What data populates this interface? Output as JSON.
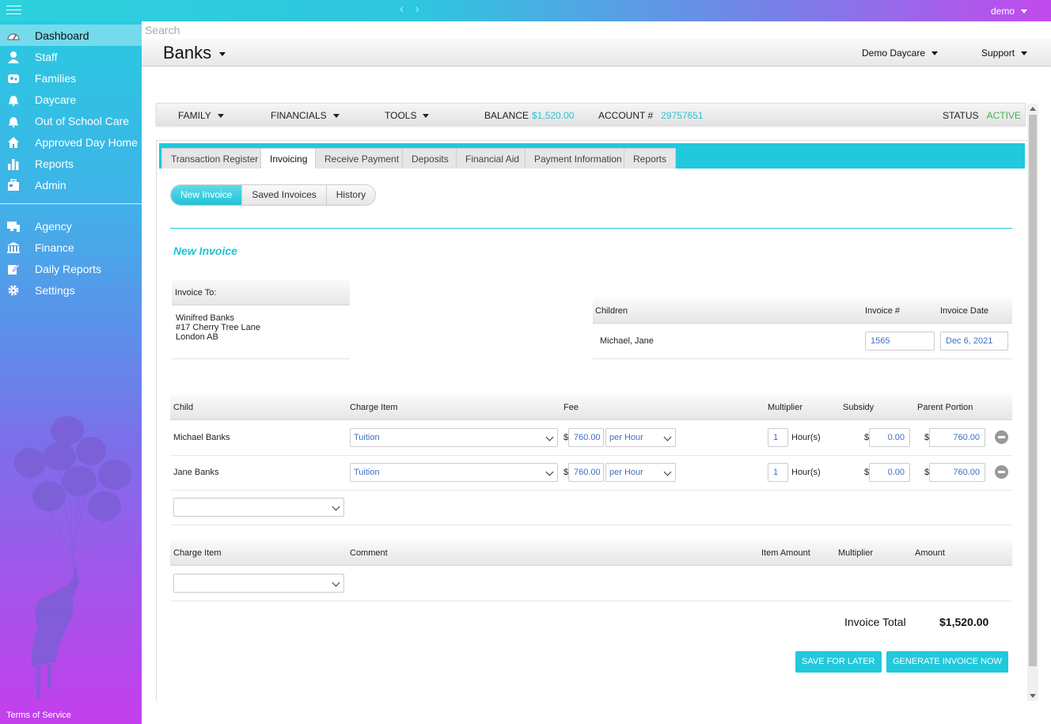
{
  "topbar": {
    "user": "demo"
  },
  "search": {
    "placeholder": "Search"
  },
  "header": {
    "title": "Banks",
    "daycare": "Demo Daycare",
    "support": "Support"
  },
  "sidebar": {
    "items": [
      {
        "label": "Dashboard",
        "icon": "gauge-icon"
      },
      {
        "label": "Staff",
        "icon": "person-icon"
      },
      {
        "label": "Families",
        "icon": "family-icon"
      },
      {
        "label": "Daycare",
        "icon": "bell-icon"
      },
      {
        "label": "Out of School Care",
        "icon": "bell-icon"
      },
      {
        "label": "Approved Day Home",
        "icon": "home-icon"
      },
      {
        "label": "Reports",
        "icon": "bar-chart-icon"
      },
      {
        "label": "Admin",
        "icon": "admin-icon"
      }
    ],
    "items2": [
      {
        "label": "Agency",
        "icon": "agency-icon"
      },
      {
        "label": "Finance",
        "icon": "bank-icon"
      },
      {
        "label": "Daily Reports",
        "icon": "edit-icon"
      },
      {
        "label": "Settings",
        "icon": "gear-icon"
      }
    ],
    "terms": "Terms of Service"
  },
  "famBar": {
    "family": "FAMILY",
    "financials": "FINANCIALS",
    "tools": "TOOLS",
    "balance_label": "BALANCE",
    "balance": "$1,520.00",
    "account_label": "ACCOUNT #",
    "account": "29757651",
    "status_label": "STATUS",
    "status": "ACTIVE"
  },
  "tabs": [
    "Transaction Register",
    "Invoicing",
    "Receive Payment",
    "Deposits",
    "Financial Aid",
    "Payment Information",
    "Reports"
  ],
  "pills": [
    "New Invoice",
    "Saved Invoices",
    "History"
  ],
  "section_title": "New Invoice",
  "invoice_to": {
    "label": "Invoice To:",
    "name": "Winifred Banks",
    "address1": "#17 Cherry Tree Lane",
    "address2": "London AB"
  },
  "invoice_meta": {
    "children_label": "Children",
    "number_label": "Invoice #",
    "date_label": "Invoice Date",
    "children": "Michael, Jane",
    "number": "1565",
    "date": "Dec 6, 2021"
  },
  "charges": {
    "headers": {
      "child": "Child",
      "charge_item": "Charge Item",
      "fee": "Fee",
      "multiplier": "Multiplier",
      "subsidy": "Subsidy",
      "parent_portion": "Parent Portion"
    },
    "rows": [
      {
        "child": "Michael Banks",
        "item": "Tuition",
        "currency": "$",
        "fee": "760.00",
        "unit": "per Hour",
        "multiplier": "1",
        "mult_unit": "Hour(s)",
        "subsidy": "0.00",
        "parent": "760.00"
      },
      {
        "child": "Jane Banks",
        "item": "Tuition",
        "currency": "$",
        "fee": "760.00",
        "unit": "per Hour",
        "multiplier": "1",
        "mult_unit": "Hour(s)",
        "subsidy": "0.00",
        "parent": "760.00"
      }
    ]
  },
  "items": {
    "headers": {
      "charge_item": "Charge Item",
      "comment": "Comment",
      "item_amount": "Item Amount",
      "multiplier": "Multiplier",
      "amount": "Amount"
    }
  },
  "total": {
    "label": "Invoice Total",
    "value": "$1,520.00"
  },
  "buttons": {
    "save": "SAVE FOR LATER",
    "generate": "GENERATE INVOICE NOW"
  },
  "colors": {
    "accent": "#20c9dc",
    "status_active": "#4caf50",
    "link_value": "#3f6fc3"
  }
}
